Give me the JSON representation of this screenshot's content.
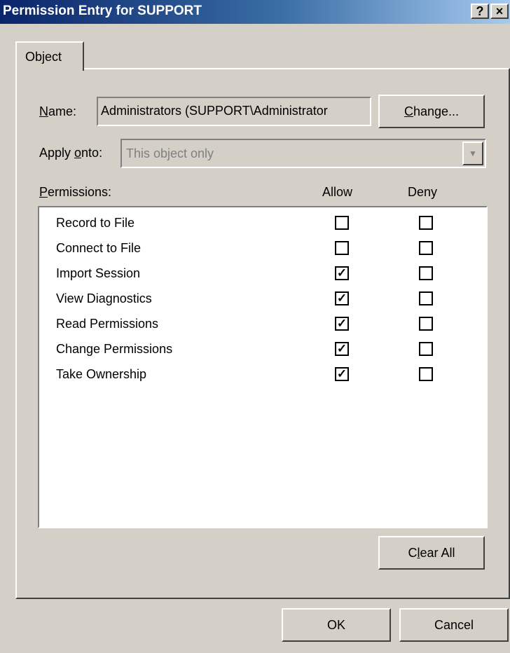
{
  "window": {
    "title": "Permission Entry for SUPPORT",
    "help_label": "?",
    "close_label": "×"
  },
  "tab": {
    "label": "Object"
  },
  "name": {
    "label_access_key": "N",
    "label_rest": "ame:",
    "value": "Administrators (SUPPORT\\Administrator",
    "change_access_key": "C",
    "change_rest": "hange..."
  },
  "apply_onto": {
    "label_before": "Apply ",
    "label_access_key": "o",
    "label_after": "nto:",
    "value": "This object only",
    "dropdown_icon": "chevron-down-icon"
  },
  "permissions": {
    "label_access_key": "P",
    "label_rest": "ermissions:",
    "allow_header": "Allow",
    "deny_header": "Deny",
    "check_glyph": "✓",
    "items": [
      {
        "name": "Record to File",
        "allow": false,
        "deny": false
      },
      {
        "name": "Connect to File",
        "allow": false,
        "deny": false
      },
      {
        "name": "Import Session",
        "allow": true,
        "deny": false
      },
      {
        "name": "View Diagnostics",
        "allow": true,
        "deny": false
      },
      {
        "name": "Read Permissions",
        "allow": true,
        "deny": false
      },
      {
        "name": "Change Permissions",
        "allow": true,
        "deny": false
      },
      {
        "name": "Take Ownership",
        "allow": true,
        "deny": false
      }
    ]
  },
  "buttons": {
    "clear_before": "C",
    "clear_access_key": "l",
    "clear_after": "ear All",
    "ok": "OK",
    "cancel": "Cancel"
  }
}
